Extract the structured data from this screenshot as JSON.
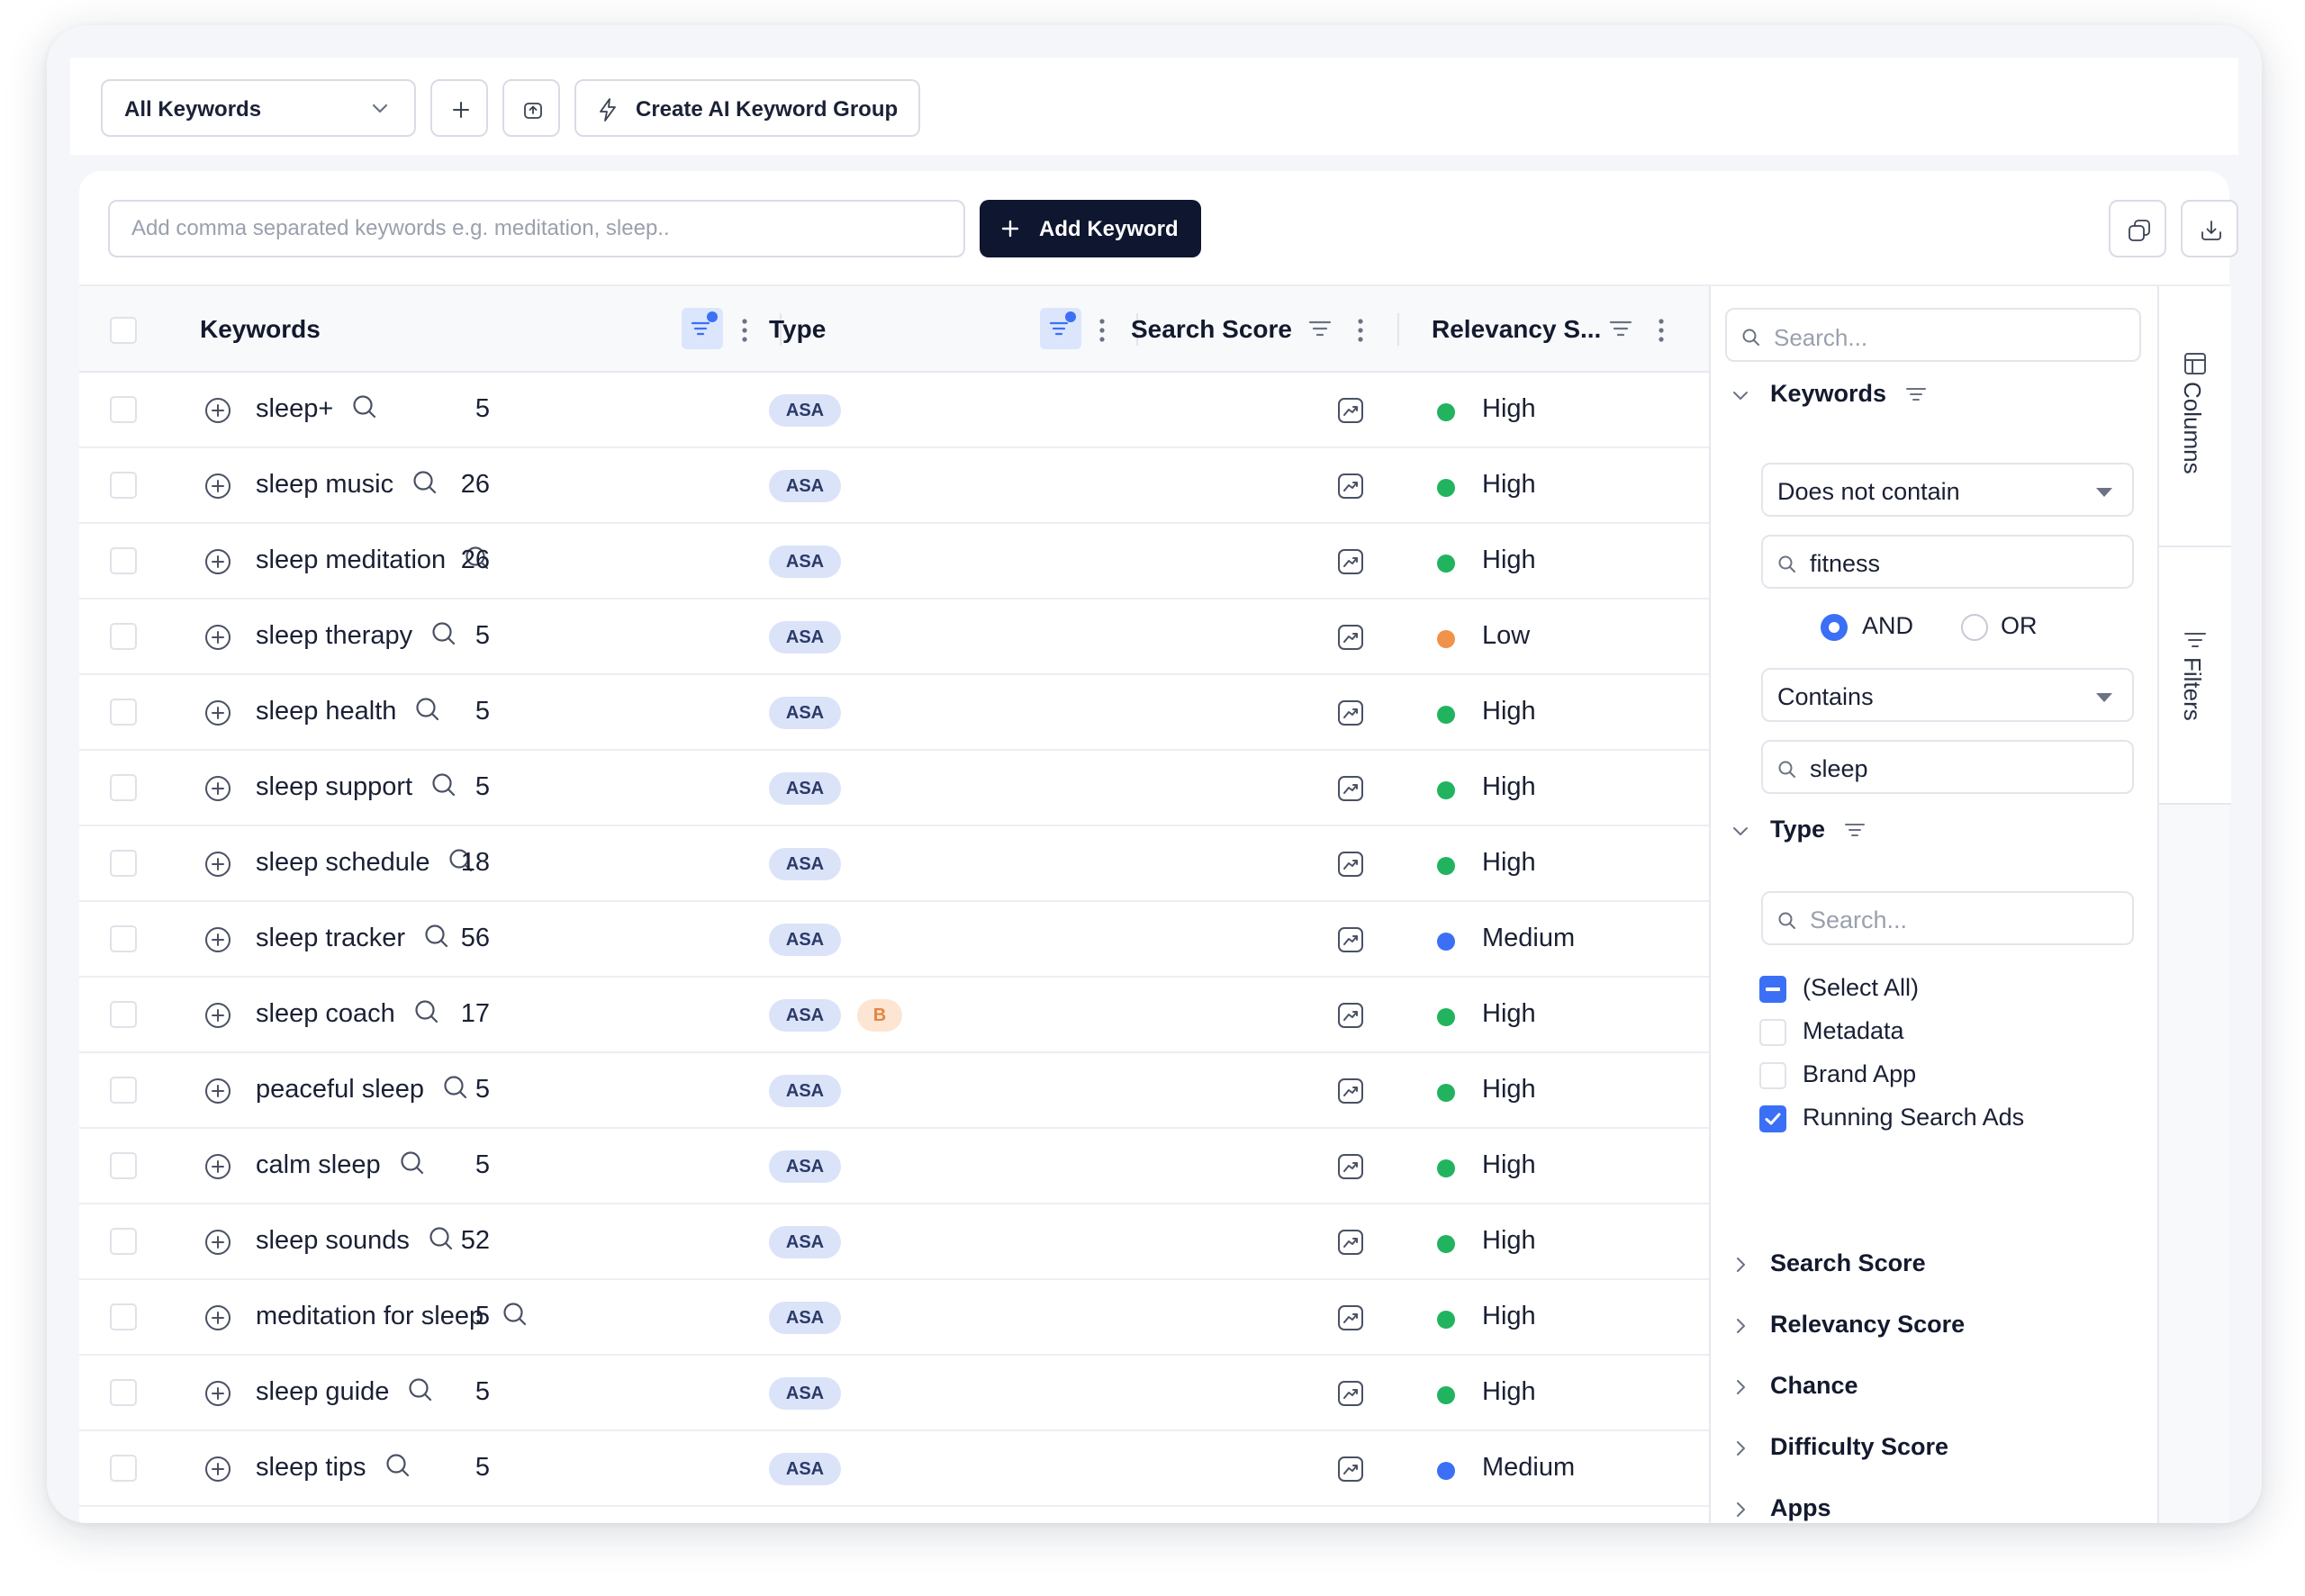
{
  "toolbar": {
    "group_select": "All Keywords",
    "ai_group_label": "Create AI Keyword Group"
  },
  "keyword_entry": {
    "placeholder": "Add comma separated keywords e.g. meditation, sleep..",
    "add_label": "Add Keyword"
  },
  "grid": {
    "columns": {
      "keywords": "Keywords",
      "type": "Type",
      "search_score": "Search Score",
      "relevancy": "Relevancy S..."
    },
    "rows": [
      {
        "keyword": "sleep+",
        "badges": [
          "ASA"
        ],
        "score": "5",
        "relevancy": "High"
      },
      {
        "keyword": "sleep music",
        "badges": [
          "ASA"
        ],
        "score": "26",
        "relevancy": "High"
      },
      {
        "keyword": "sleep meditation",
        "badges": [
          "ASA"
        ],
        "score": "26",
        "relevancy": "High"
      },
      {
        "keyword": "sleep therapy",
        "badges": [
          "ASA"
        ],
        "score": "5",
        "relevancy": "Low"
      },
      {
        "keyword": "sleep health",
        "badges": [
          "ASA"
        ],
        "score": "5",
        "relevancy": "High"
      },
      {
        "keyword": "sleep support",
        "badges": [
          "ASA"
        ],
        "score": "5",
        "relevancy": "High"
      },
      {
        "keyword": "sleep schedule",
        "badges": [
          "ASA"
        ],
        "score": "18",
        "relevancy": "High"
      },
      {
        "keyword": "sleep tracker",
        "badges": [
          "ASA"
        ],
        "score": "56",
        "relevancy": "Medium"
      },
      {
        "keyword": "sleep coach",
        "badges": [
          "ASA",
          "B"
        ],
        "score": "17",
        "relevancy": "High"
      },
      {
        "keyword": "peaceful sleep",
        "badges": [
          "ASA"
        ],
        "score": "5",
        "relevancy": "High"
      },
      {
        "keyword": "calm sleep",
        "badges": [
          "ASA"
        ],
        "score": "5",
        "relevancy": "High"
      },
      {
        "keyword": "sleep sounds",
        "badges": [
          "ASA"
        ],
        "score": "52",
        "relevancy": "High"
      },
      {
        "keyword": "meditation for sleep",
        "badges": [
          "ASA"
        ],
        "score": "5",
        "relevancy": "High"
      },
      {
        "keyword": "sleep guide",
        "badges": [
          "ASA"
        ],
        "score": "5",
        "relevancy": "High"
      },
      {
        "keyword": "sleep tips",
        "badges": [
          "ASA"
        ],
        "score": "5",
        "relevancy": "Medium"
      }
    ]
  },
  "relevancy_colors": {
    "High": "#22b35e",
    "Medium": "#3b6ff5",
    "Low": "#f0924a"
  },
  "filters": {
    "search_placeholder": "Search...",
    "keywords_section": "Keywords",
    "condition1": "Does not contain",
    "value1": "fitness",
    "and_label": "AND",
    "or_label": "OR",
    "operator_selected": "AND",
    "condition2": "Contains",
    "value2": "sleep",
    "type_section": "Type",
    "type_search_placeholder": "Search...",
    "type_options": [
      {
        "label": "(Select All)",
        "state": "indeterminate"
      },
      {
        "label": "Metadata",
        "state": "unchecked"
      },
      {
        "label": "Brand App",
        "state": "unchecked"
      },
      {
        "label": "Running Search Ads",
        "state": "checked"
      }
    ],
    "collapsed_sections": [
      "Search Score",
      "Relevancy Score",
      "Chance",
      "Difficulty Score",
      "Apps"
    ]
  },
  "side_tabs": {
    "columns": "Columns",
    "filters": "Filters"
  },
  "icons": [
    "chevron-down-icon",
    "plus-icon",
    "export-icon",
    "lightning-icon",
    "copy-icon",
    "download-icon",
    "filter-icon",
    "more-vertical-icon",
    "add-circle-icon",
    "search-icon",
    "trend-icon",
    "chevron-right-icon",
    "columns-icon",
    "filters-icon"
  ]
}
